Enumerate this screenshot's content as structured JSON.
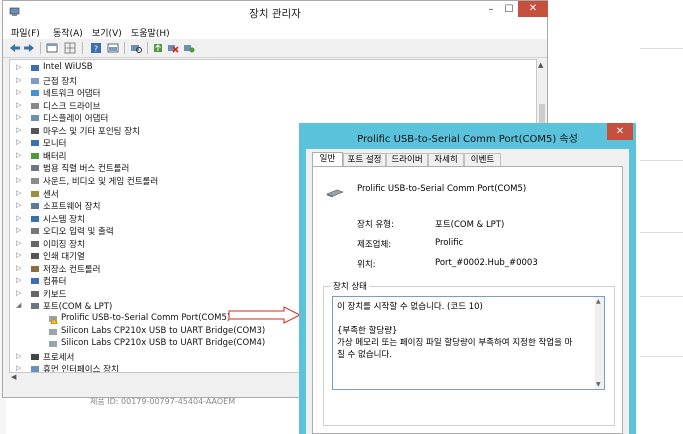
{
  "device_manager": {
    "title": "장치 관리자",
    "window_buttons": {
      "minimize": "–",
      "maximize": "☐",
      "close": "✕"
    },
    "menu": [
      "파일(F)",
      "동작(A)",
      "보기(V)",
      "도움말(H)"
    ],
    "tree": [
      {
        "label": "Intel WiUSB",
        "expanded": false
      },
      {
        "label": "근접 장치",
        "expanded": false
      },
      {
        "label": "네트워크 어댑터",
        "expanded": false
      },
      {
        "label": "디스크 드라이브",
        "expanded": false
      },
      {
        "label": "디스플레이 어댑터",
        "expanded": false
      },
      {
        "label": "마우스 및 기타 포인팅 장치",
        "expanded": false
      },
      {
        "label": "모니터",
        "expanded": false
      },
      {
        "label": "배터리",
        "expanded": false
      },
      {
        "label": "범용 직렬 버스 컨트롤러",
        "expanded": false
      },
      {
        "label": "사운드, 비디오 및 게임 컨트롤러",
        "expanded": false
      },
      {
        "label": "센서",
        "expanded": false
      },
      {
        "label": "소프트웨어 장치",
        "expanded": false
      },
      {
        "label": "시스템 장치",
        "expanded": false
      },
      {
        "label": "오디오 입력 및 출력",
        "expanded": false
      },
      {
        "label": "이미징 장치",
        "expanded": false
      },
      {
        "label": "인쇄 대기열",
        "expanded": false
      },
      {
        "label": "저장소 컨트롤러",
        "expanded": false
      },
      {
        "label": "컴퓨터",
        "expanded": false
      },
      {
        "label": "키보드",
        "expanded": false
      },
      {
        "label": "포트(COM & LPT)",
        "expanded": true
      },
      {
        "label": "Prolific USB-to-Serial Comm Port(COM5)",
        "child": true,
        "warning": true
      },
      {
        "label": "Silicon Labs CP210x USB to UART Bridge(COM3)",
        "child": true
      },
      {
        "label": "Silicon Labs CP210x USB to UART Bridge(COM4)",
        "child": true
      },
      {
        "label": "프로세서",
        "expanded": false
      },
      {
        "label": "휴먼 인터페이스 장치",
        "expanded": false
      }
    ]
  },
  "background_text": "제품 ID: 00179-00797-45404-AAOEM",
  "dialog": {
    "title": "Prolific USB-to-Serial Comm Port(COM5) 속성",
    "close": "✕",
    "tabs": [
      "일반",
      "포트 설정",
      "드라이버",
      "자세히",
      "이벤트"
    ],
    "active_tab": 0,
    "device_name": "Prolific USB-to-Serial Comm Port(COM5)",
    "properties": [
      {
        "label": "장치 유형:",
        "value": "포트(COM & LPT)"
      },
      {
        "label": "제조업체:",
        "value": "Prolific"
      },
      {
        "label": "위치:",
        "value": "Port_#0002.Hub_#0003"
      }
    ],
    "status_group_title": "장치 상태",
    "status_lines": [
      "이 장치를 시작할 수 없습니다. (코드 10)",
      "",
      "{부족한 할당량}",
      "가상 메모리 또는 페이징 파일 할당량이 부족하여 지정한 작업을 마",
      "칠 수 없습니다."
    ]
  },
  "colors": {
    "dialog_frame": "#5bc2dc",
    "close_button": "#c74f3e",
    "status_border": "#7a9dc4",
    "arrow": "#d9261c"
  }
}
